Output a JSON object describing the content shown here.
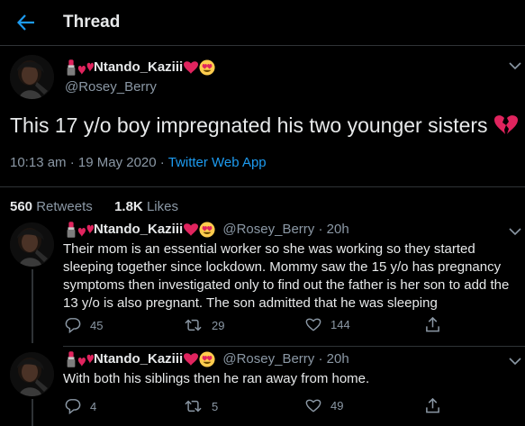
{
  "header": {
    "title": "Thread"
  },
  "main_tweet": {
    "display_name": "Ntando_Kaziii",
    "handle": "@Rosey_Berry",
    "text": "This 17 y/o boy impregnated his two younger sisters",
    "time": "10:13 am",
    "date": "19 May 2020",
    "separator": "·",
    "source": "Twitter Web App",
    "retweets_count": "560",
    "retweets_label": "Retweets",
    "likes_count": "1.8K",
    "likes_label": "Likes"
  },
  "replies": [
    {
      "display_name": "Ntando_Kaziii",
      "handle": "@Rosey_Berry",
      "age": "· 20h",
      "lines": [
        "Their mom is an essential worker so she was working so they started",
        "sleeping together since lockdown. Mommy saw the 15 y/o has pregnancy",
        "symptoms then investigated only to find out the father is her son to add the",
        "13 y/o is also pregnant. The son admitted that he was sleeping"
      ],
      "replies_count": "45",
      "retweets_count": "29",
      "likes_count": "144"
    },
    {
      "display_name": "Ntando_Kaziii",
      "handle": "@Rosey_Berry",
      "age": "· 20h",
      "lines": [
        "With both his siblings then he ran away from home."
      ],
      "replies_count": "4",
      "retweets_count": "5",
      "likes_count": "49"
    }
  ],
  "colors": {
    "accent": "#1d9bf0",
    "background": "#000000",
    "muted": "#8b98a5"
  },
  "icons": [
    "back-arrow-icon",
    "lipstick-emoji",
    "hearts-emoji",
    "heart-eyes-emoji",
    "broken-heart-emoji",
    "reply-icon",
    "retweet-icon",
    "like-icon",
    "share-icon",
    "chevron-down-icon"
  ]
}
